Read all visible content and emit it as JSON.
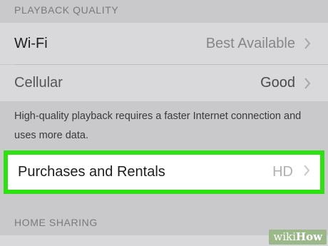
{
  "playback": {
    "header": "PLAYBACK QUALITY",
    "rows": [
      {
        "label": "Wi-Fi",
        "value": "Best Available"
      },
      {
        "label": "Cellular",
        "value": "Good"
      }
    ],
    "footer": "High-quality playback requires a faster Internet connection and uses more data."
  },
  "purchases": {
    "label": "Purchases and Rentals",
    "value": "HD"
  },
  "home_sharing": {
    "header": "HOME SHARING"
  },
  "watermark": {
    "wiki": "wiki",
    "how": "How"
  },
  "colors": {
    "background": "#c9c9cc",
    "row_background": "#d9d9db",
    "highlight_border": "#2fe013",
    "watermark_bg": "#9bb889"
  },
  "icons": {
    "chevron": "chevron-right-icon"
  }
}
